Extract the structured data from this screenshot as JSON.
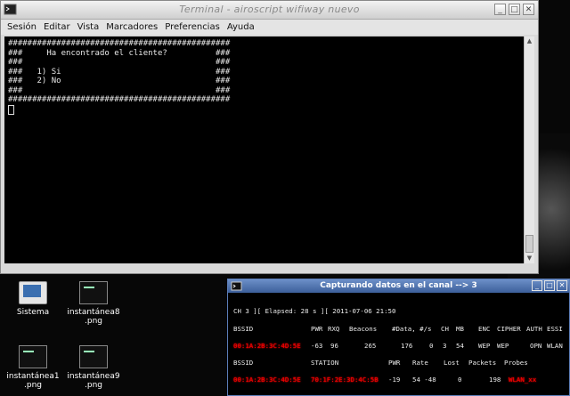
{
  "terminal": {
    "title": "Terminal - airoscript wifiway nuevo",
    "menu": [
      "Sesión",
      "Editar",
      "Vista",
      "Marcadores",
      "Preferencias",
      "Ayuda"
    ],
    "lines": [
      "##############################################",
      "###     Ha encontrado el cliente?          ###",
      "###                                        ###",
      "###   1) Si                                ###",
      "###   2) No                                ###",
      "###                                        ###",
      "##############################################"
    ]
  },
  "desktop": {
    "icons": [
      {
        "label": "Sistema",
        "icon": "computer-icon"
      },
      {
        "label": "instantánea8\n.png",
        "icon": "image-file-icon"
      },
      {
        "label": "instantánea1\n.png",
        "icon": "image-file-icon"
      },
      {
        "label": "instantánea9\n.png",
        "icon": "image-file-icon"
      }
    ]
  },
  "airodump": {
    "title": "Capturando datos en el canal -->   3",
    "status_line": "CH  3 ][ Elapsed: 28 s ][ 2011-07-06 21:50",
    "ap_header": [
      "BSSID",
      "PWR",
      "RXQ",
      "Beacons",
      "#Data, #/s",
      "CH",
      "MB",
      "ENC",
      "CIPHER",
      "AUTH",
      "ESSI"
    ],
    "ap_row": [
      "00:1A:2B:3C:4D:5E",
      "-63",
      "96",
      "265",
      "176",
      "0",
      "3",
      "54",
      "WEP",
      "WEP",
      "OPN",
      "WLAN"
    ],
    "sta_header": [
      "BSSID",
      "STATION",
      "PWR",
      "Rate",
      "Lost",
      "Packets",
      "Probes"
    ],
    "sta_row": [
      "00:1A:2B:3C:4D:5E",
      "70:1F:2E:3D:4C:5B",
      "-19",
      "54 -48",
      "0",
      "198",
      "WLAN_xx"
    ]
  }
}
